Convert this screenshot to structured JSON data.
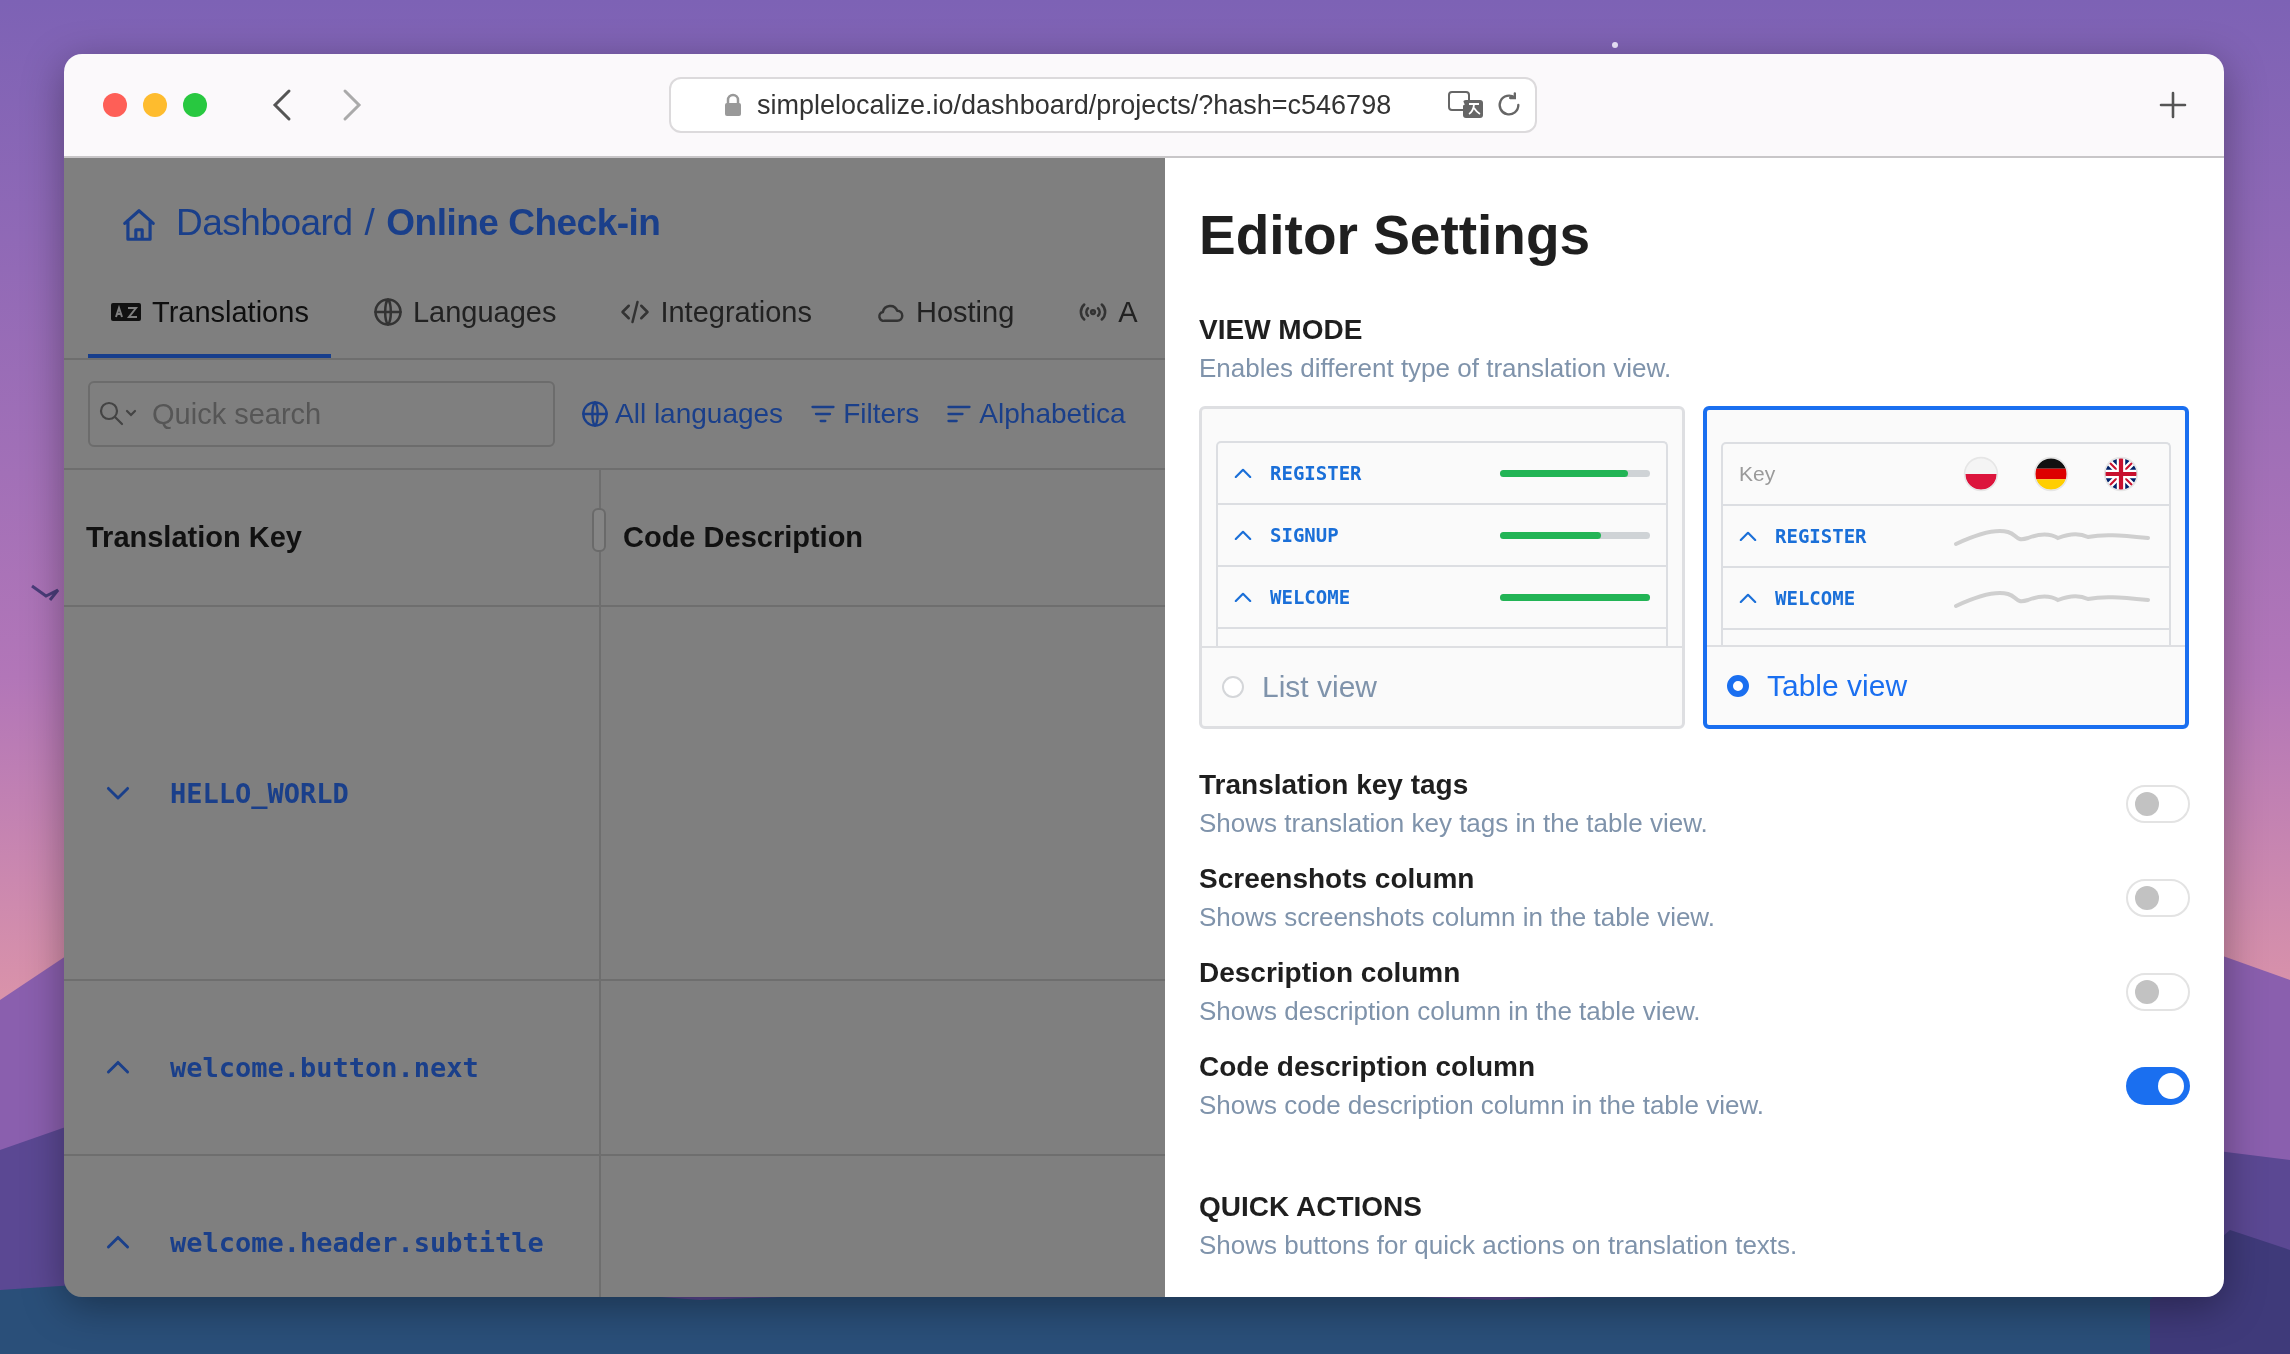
{
  "browser": {
    "url": "simplelocalize.io/dashboard/projects/?hash=c546798"
  },
  "breadcrumb": [
    {
      "label": "Dashboard",
      "current": false
    },
    {
      "label": "/",
      "current": false
    },
    {
      "label": "Online Check-in",
      "current": true
    }
  ],
  "tabs": [
    {
      "label": "Translations",
      "kind": "translate",
      "selected": true
    },
    {
      "label": "Languages",
      "kind": "globe",
      "selected": false
    },
    {
      "label": "Integrations",
      "kind": "code",
      "selected": false
    },
    {
      "label": "Hosting",
      "kind": "cloud",
      "selected": false
    },
    {
      "label": "A",
      "kind": "broadcast",
      "selected": false
    }
  ],
  "search": {
    "placeholder": "Quick search"
  },
  "filters": [
    {
      "label": "All languages",
      "kind": "globe"
    },
    {
      "label": "Filters",
      "kind": "filter"
    },
    {
      "label": "Alphabetica",
      "kind": "sort"
    }
  ],
  "table": {
    "columns": [
      "Translation Key",
      "Code Description"
    ],
    "rows": [
      {
        "key": "HELLO_WORLD",
        "expanded": true
      },
      {
        "key": "welcome.button.next",
        "expanded": false
      },
      {
        "key": "welcome.header.subtitle",
        "expanded": false
      }
    ]
  },
  "settings": {
    "title": "Editor Settings",
    "view_mode": {
      "heading": "VIEW MODE",
      "description": "Enables different type of translation view.",
      "options": [
        {
          "label": "List view",
          "kind": "list",
          "selected": false,
          "rows": [
            {
              "key": "REGISTER",
              "level": 0.85
            },
            {
              "key": "SIGNUP",
              "level": 0.67
            },
            {
              "key": "WELCOME",
              "level": 1
            }
          ]
        },
        {
          "label": "Table view",
          "kind": "table",
          "selected": true,
          "header": "Key",
          "rows": [
            {
              "key": "REGISTER"
            },
            {
              "key": "WELCOME"
            }
          ]
        }
      ]
    },
    "toggles": [
      {
        "title": "Translation key tags",
        "description": "Shows translation key tags in the table view.",
        "on": false
      },
      {
        "title": "Screenshots column",
        "description": "Shows screenshots column in the table view.",
        "on": false
      },
      {
        "title": "Description column",
        "description": "Shows description column in the table view.",
        "on": false
      },
      {
        "title": "Code description column",
        "description": "Shows code description column in the table view.",
        "on": true
      }
    ],
    "quick_actions": {
      "heading": "QUICK ACTIONS",
      "description": "Shows buttons for quick actions on translation texts."
    }
  }
}
